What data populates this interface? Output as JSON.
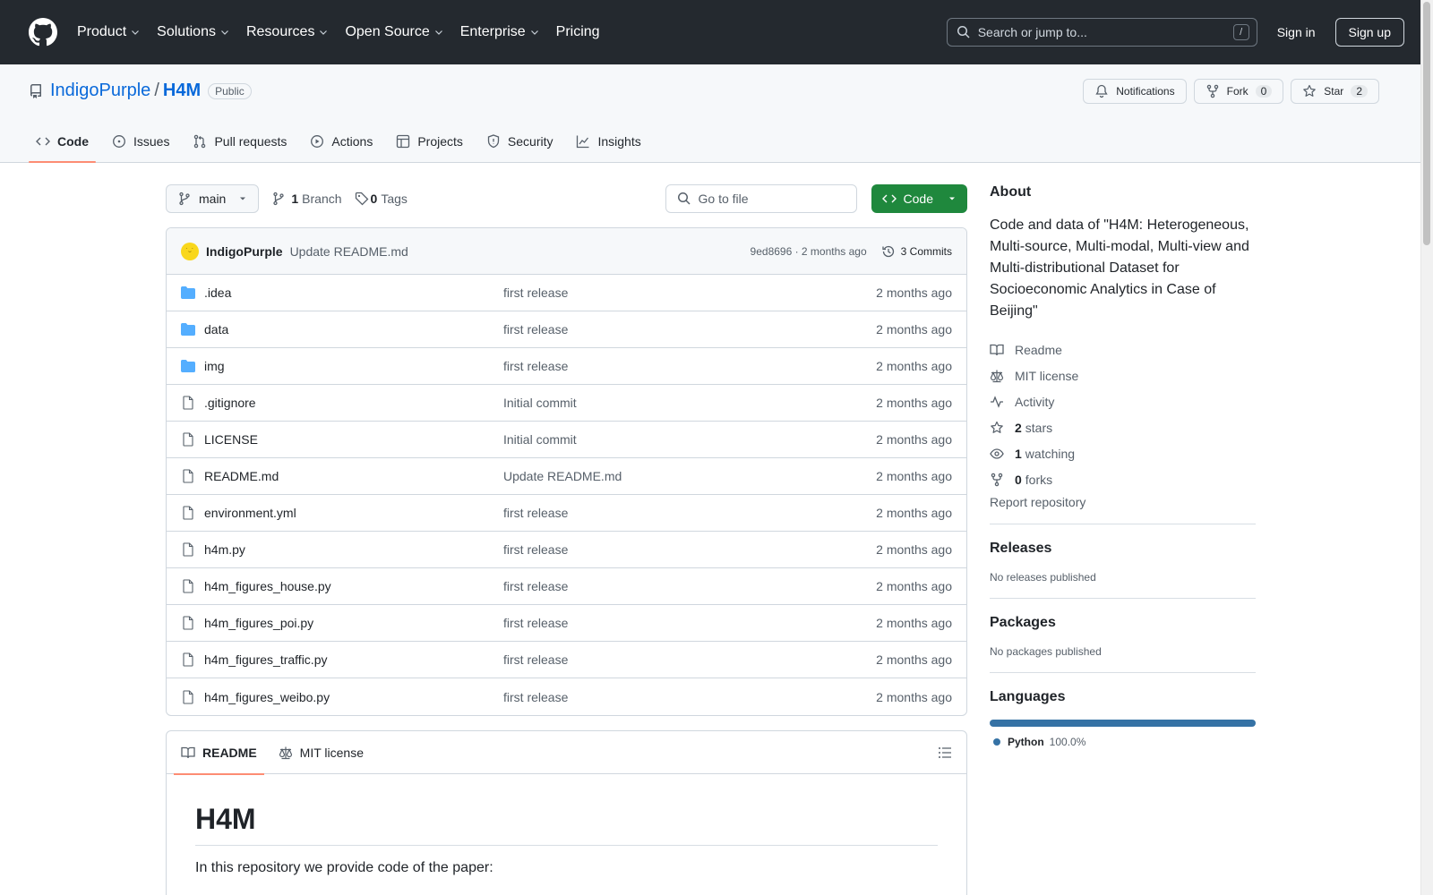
{
  "header": {
    "nav": [
      {
        "label": "Product",
        "dropdown": true
      },
      {
        "label": "Solutions",
        "dropdown": true
      },
      {
        "label": "Resources",
        "dropdown": true
      },
      {
        "label": "Open Source",
        "dropdown": true
      },
      {
        "label": "Enterprise",
        "dropdown": true
      },
      {
        "label": "Pricing",
        "dropdown": false
      }
    ],
    "search_placeholder": "Search or jump to...",
    "search_shortcut": "/",
    "signin": "Sign in",
    "signup": "Sign up"
  },
  "repo": {
    "owner": "IndigoPurple",
    "separator": "/",
    "name": "H4M",
    "visibility": "Public",
    "notifications": "Notifications",
    "fork_label": "Fork",
    "fork_count": "0",
    "star_label": "Star",
    "star_count": "2",
    "tabs": [
      "Code",
      "Issues",
      "Pull requests",
      "Actions",
      "Projects",
      "Security",
      "Insights"
    ]
  },
  "toolbar": {
    "branch": "main",
    "branch_count": "1",
    "branch_label": "Branch",
    "tag_count": "0",
    "tag_label": "Tags",
    "gofile": "Go to file",
    "code": "Code"
  },
  "commit": {
    "author": "IndigoPurple",
    "message": "Update README.md",
    "meta": "9ed8696 · 2 months ago",
    "commits": "3 Commits"
  },
  "files": [
    {
      "name": ".idea",
      "type": "dir",
      "message": "first release",
      "age": "2 months ago"
    },
    {
      "name": "data",
      "type": "dir",
      "message": "first release",
      "age": "2 months ago"
    },
    {
      "name": "img",
      "type": "dir",
      "message": "first release",
      "age": "2 months ago"
    },
    {
      "name": ".gitignore",
      "type": "file",
      "message": "Initial commit",
      "age": "2 months ago"
    },
    {
      "name": "LICENSE",
      "type": "file",
      "message": "Initial commit",
      "age": "2 months ago"
    },
    {
      "name": "README.md",
      "type": "file",
      "message": "Update README.md",
      "age": "2 months ago"
    },
    {
      "name": "environment.yml",
      "type": "file",
      "message": "first release",
      "age": "2 months ago"
    },
    {
      "name": "h4m.py",
      "type": "file",
      "message": "first release",
      "age": "2 months ago"
    },
    {
      "name": "h4m_figures_house.py",
      "type": "file",
      "message": "first release",
      "age": "2 months ago"
    },
    {
      "name": "h4m_figures_poi.py",
      "type": "file",
      "message": "first release",
      "age": "2 months ago"
    },
    {
      "name": "h4m_figures_traffic.py",
      "type": "file",
      "message": "first release",
      "age": "2 months ago"
    },
    {
      "name": "h4m_figures_weibo.py",
      "type": "file",
      "message": "first release",
      "age": "2 months ago"
    }
  ],
  "readme": {
    "tab_readme": "README",
    "tab_license": "MIT license",
    "heading": "H4M",
    "intro": "In this repository we provide code of the paper:"
  },
  "sidebar": {
    "about_title": "About",
    "description": "Code and data of \"H4M: Heterogeneous, Multi-source, Multi-modal, Multi-view and Multi-distributional Dataset for Socioeconomic Analytics in Case of Beijing\"",
    "readme": "Readme",
    "license": "MIT license",
    "activity": "Activity",
    "stars_count": "2",
    "stars_label": "stars",
    "watching_count": "1",
    "watching_label": "watching",
    "forks_count": "0",
    "forks_label": "forks",
    "report": "Report repository",
    "releases_title": "Releases",
    "releases_text": "No releases published",
    "packages_title": "Packages",
    "packages_text": "No packages published",
    "languages_title": "Languages",
    "language_name": "Python",
    "language_pct": "100.0%",
    "language_color": "#3572A5"
  }
}
